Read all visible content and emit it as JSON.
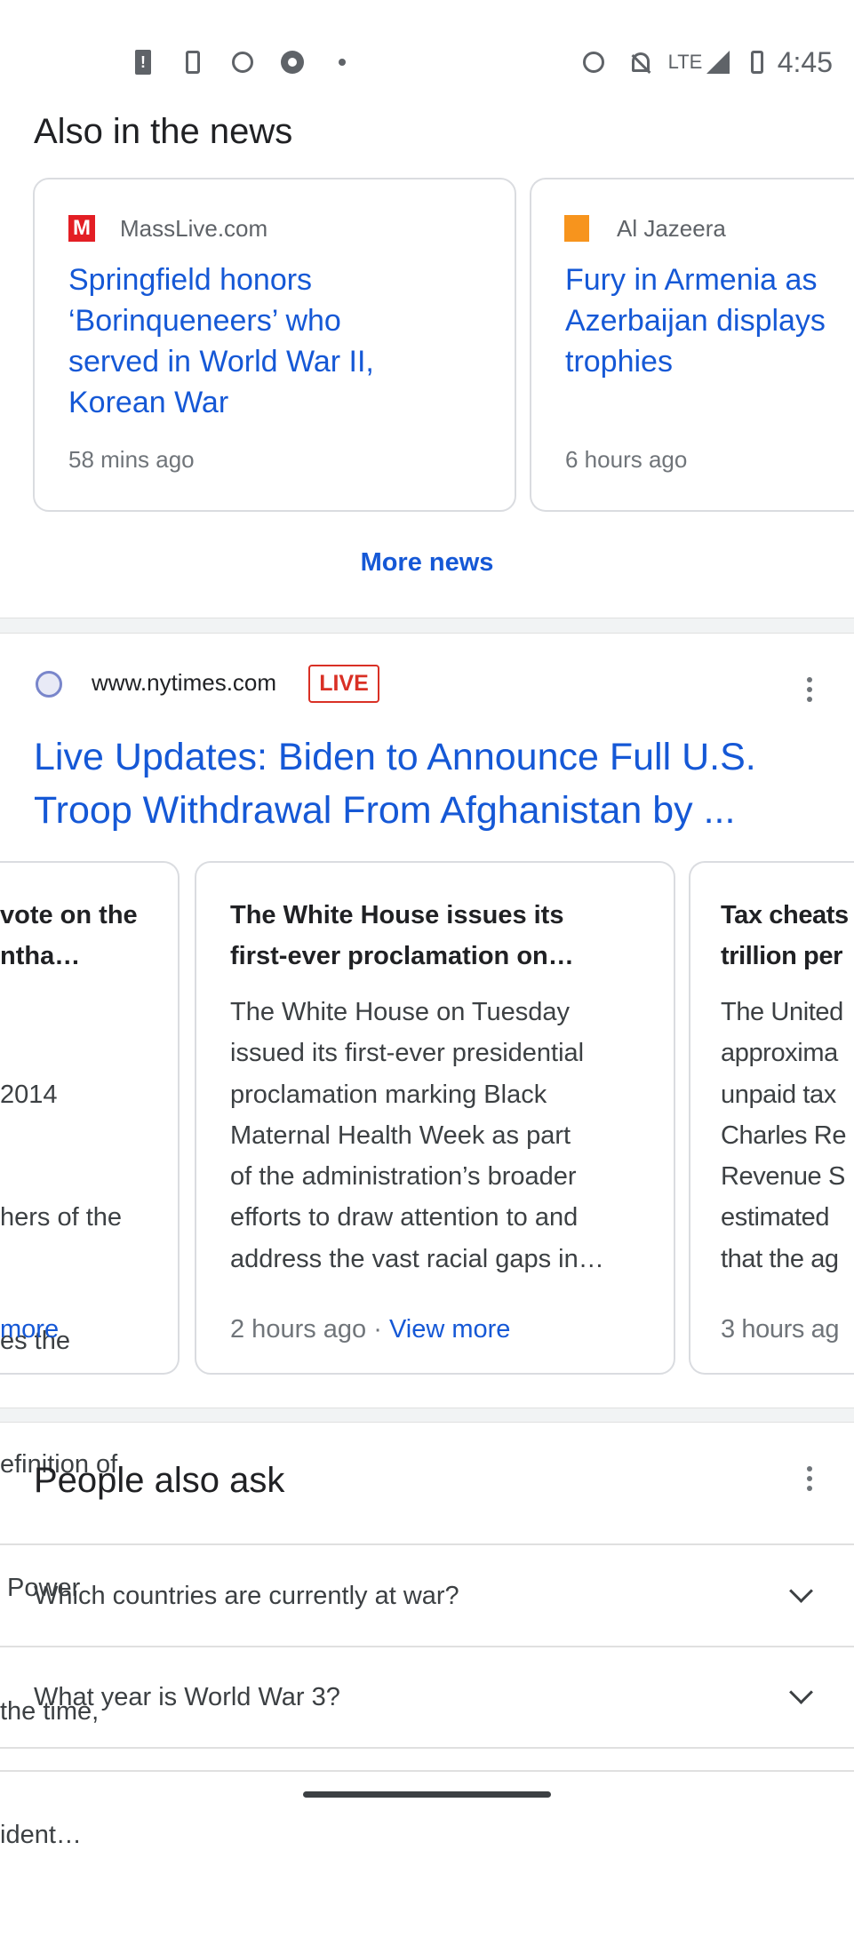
{
  "status_bar": {
    "left_icons": [
      "battery-alert-icon",
      "phone-sync-icon",
      "alarm-icon",
      "chrome-icon",
      "dot-icon"
    ],
    "right_icons": [
      "alarm-icon",
      "notifications-off-icon",
      "lte-icon",
      "signal-icon",
      "battery-icon"
    ],
    "network": "LTE",
    "time": "4:45"
  },
  "also_in_news": {
    "title": "Also in the news",
    "cards": [
      {
        "source": "MassLive.com",
        "logo_color": "#e31e24",
        "title_lines": [
          "Springfield honors",
          "‘Borinqueneers’ who",
          "served in World War II,",
          "Korean War"
        ],
        "time": "58 mins ago"
      },
      {
        "source": "Al Jazeera",
        "logo_color": "#f7941d",
        "title_lines": [
          "Fury in Armenia as",
          "Azerbaijan displays",
          "trophies"
        ],
        "time": "6 hours ago"
      }
    ],
    "more_news": "More news"
  },
  "result": {
    "site": "www.nytimes.com",
    "badge": "LIVE",
    "headline_lines": [
      "Live Updates: Biden to Announce Full U.S.",
      "Troop Withdrawal From Afghanistan by ..."
    ],
    "stories": [
      {
        "title_lines": [
          "vote on the",
          "ntha…"
        ],
        "snippet_lines": [
          "2014",
          "hers of the",
          "es the",
          "efinition of",
          " Power",
          "the time,",
          "ident…"
        ],
        "time": "",
        "view_more": "more"
      },
      {
        "title_lines": [
          "The White House issues its",
          "first-ever proclamation on…"
        ],
        "snippet_lines": [
          "The White House on Tuesday",
          "issued its first-ever presidential",
          "proclamation marking Black",
          "Maternal Health Week as part",
          "of the administration’s broader",
          "efforts to draw attention to and",
          "address the vast racial gaps in…"
        ],
        "time": "2 hours ago",
        "separator": " · ",
        "view_more": "View more"
      },
      {
        "title_lines": [
          "Tax cheats",
          "trillion per"
        ],
        "snippet_lines": [
          "The United",
          "approxima",
          "unpaid tax",
          "Charles Re",
          "Revenue S",
          "estimated",
          "that the ag"
        ],
        "time": "3 hours ag"
      }
    ]
  },
  "people_also_ask": {
    "title": "People also ask",
    "questions": [
      "Which countries are currently at war?",
      "What year is World War 3?"
    ]
  },
  "colors": {
    "link": "#1558d6",
    "live": "#d93025",
    "text": "#202124",
    "secondary": "#70757a"
  }
}
